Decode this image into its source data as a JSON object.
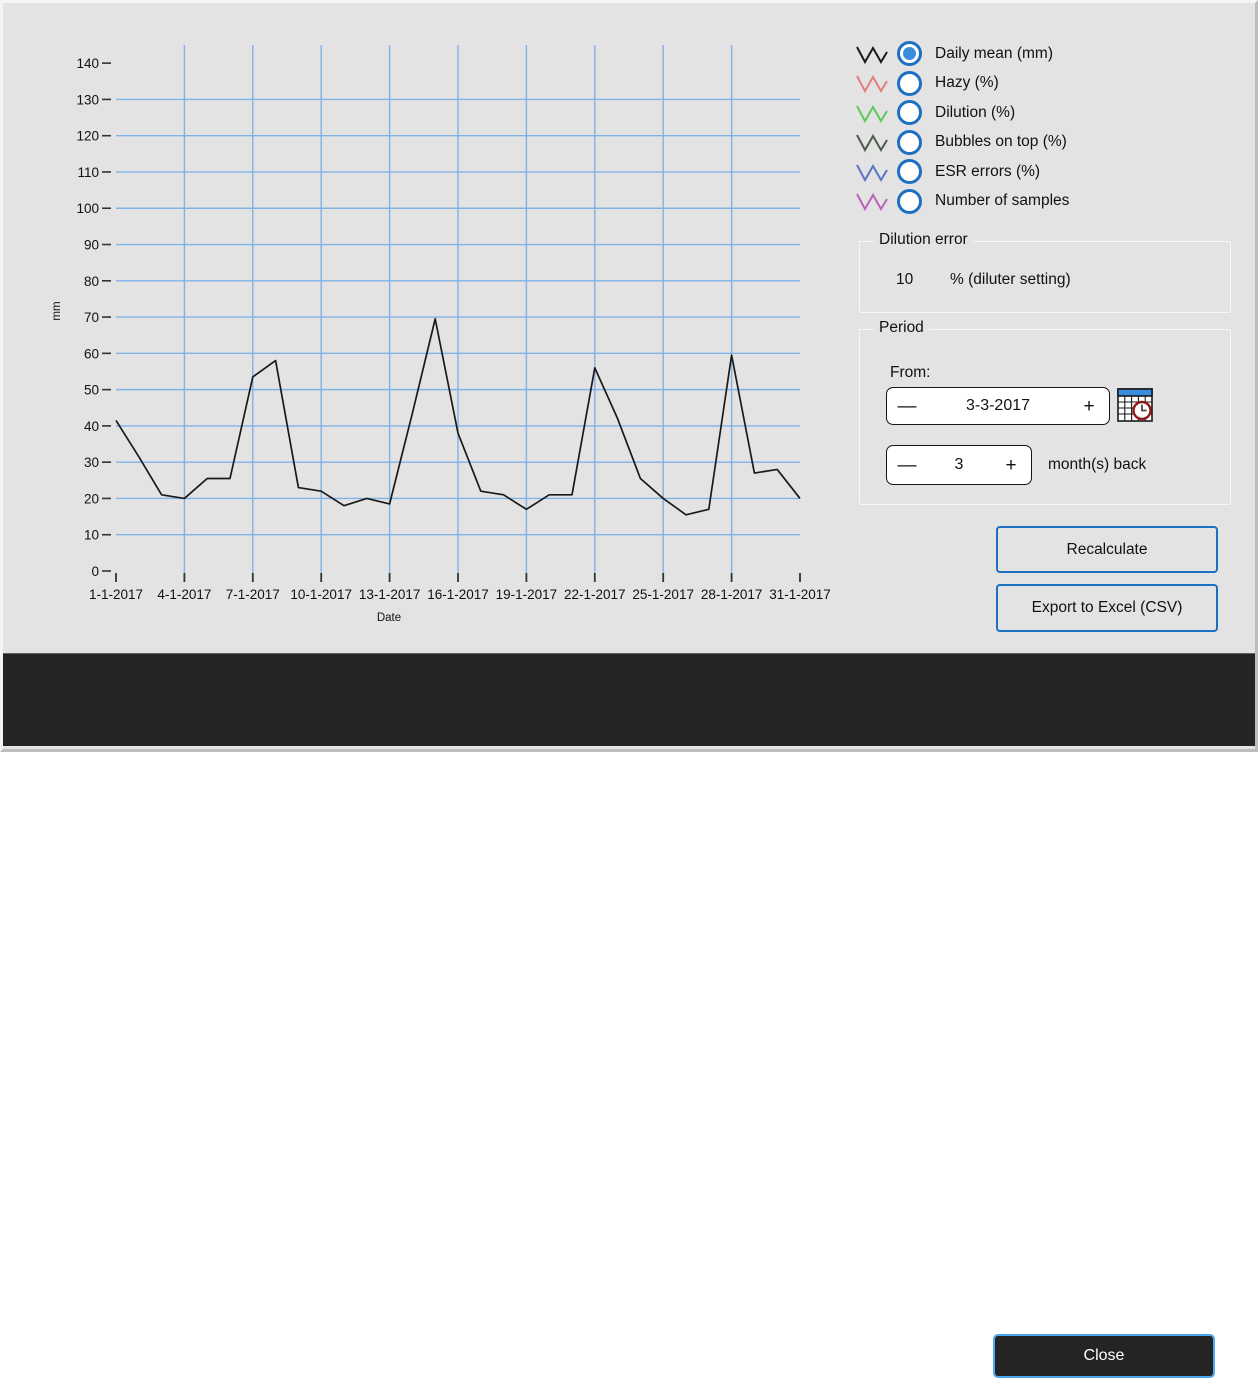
{
  "window": {
    "background": "#e3e3e3",
    "footer_background": "#242424",
    "accent": "#1d6fc1"
  },
  "legend": {
    "items": [
      {
        "label": "Daily mean (mm)",
        "color": "#1a1a1a",
        "selected": true
      },
      {
        "label": "Hazy (%)",
        "color": "#e08080",
        "selected": false
      },
      {
        "label": "Dilution (%)",
        "color": "#5cc95c",
        "selected": false
      },
      {
        "label": "Bubbles on top (%)",
        "color": "#4c5c4c",
        "selected": false
      },
      {
        "label": "ESR errors (%)",
        "color": "#5b74c8",
        "selected": false
      },
      {
        "label": "Number of samples",
        "color": "#b964b9",
        "selected": false
      }
    ]
  },
  "dilution_error": {
    "title": "Dilution error",
    "value": "10",
    "unit": "% (diluter setting)"
  },
  "period": {
    "title": "Period",
    "from_label": "From:",
    "date_value": "3-3-2017",
    "months_value": "3",
    "months_label": "month(s) back",
    "minus_label": "—",
    "plus_label": "+",
    "calendar_icon": "calendar-clock-icon"
  },
  "buttons": {
    "recalculate": "Recalculate",
    "export": "Export to Excel (CSV)",
    "close": "Close"
  },
  "chart_data": {
    "type": "line",
    "title": "",
    "xlabel": "Date",
    "ylabel": "mm",
    "ylim": [
      0,
      145
    ],
    "yticks": [
      0,
      10,
      20,
      30,
      40,
      50,
      60,
      70,
      80,
      90,
      100,
      110,
      120,
      130,
      140
    ],
    "ytick_labels": [
      "0",
      "10",
      "20",
      "30",
      "40",
      "50",
      "60",
      "70",
      "80",
      "90",
      "100",
      "110",
      "120",
      "130",
      "140"
    ],
    "xtick_labels": [
      "1-1-2017",
      "4-1-2017",
      "7-1-2017",
      "10-1-2017",
      "13-1-2017",
      "16-1-2017",
      "19-1-2017",
      "22-1-2017",
      "25-1-2017",
      "28-1-2017",
      "31-1-2017"
    ],
    "xtick_days": [
      1,
      4,
      7,
      10,
      13,
      16,
      19,
      22,
      25,
      28,
      31
    ],
    "grid": true,
    "grid_color": "#7fb3e8",
    "legend_position": "right-outside",
    "x": [
      1,
      2,
      3,
      4,
      5,
      6,
      7,
      8,
      9,
      10,
      11,
      12,
      13,
      14,
      15,
      16,
      17,
      18,
      19,
      20,
      21,
      22,
      23,
      24,
      25,
      26,
      27,
      28,
      29,
      30,
      31
    ],
    "series": [
      {
        "name": "Daily mean (mm)",
        "color": "#1a1a1a",
        "values": [
          41.5,
          31.5,
          21.0,
          20.0,
          25.5,
          25.5,
          53.5,
          58.0,
          23.0,
          22.0,
          18.0,
          20.0,
          18.5,
          43.5,
          69.5,
          38.0,
          22.0,
          21.0,
          17.0,
          21.0,
          21.0,
          56.0,
          42.0,
          25.5,
          20.0,
          15.5,
          17.0,
          59.5,
          27.0,
          28.0,
          20.0
        ]
      }
    ]
  }
}
